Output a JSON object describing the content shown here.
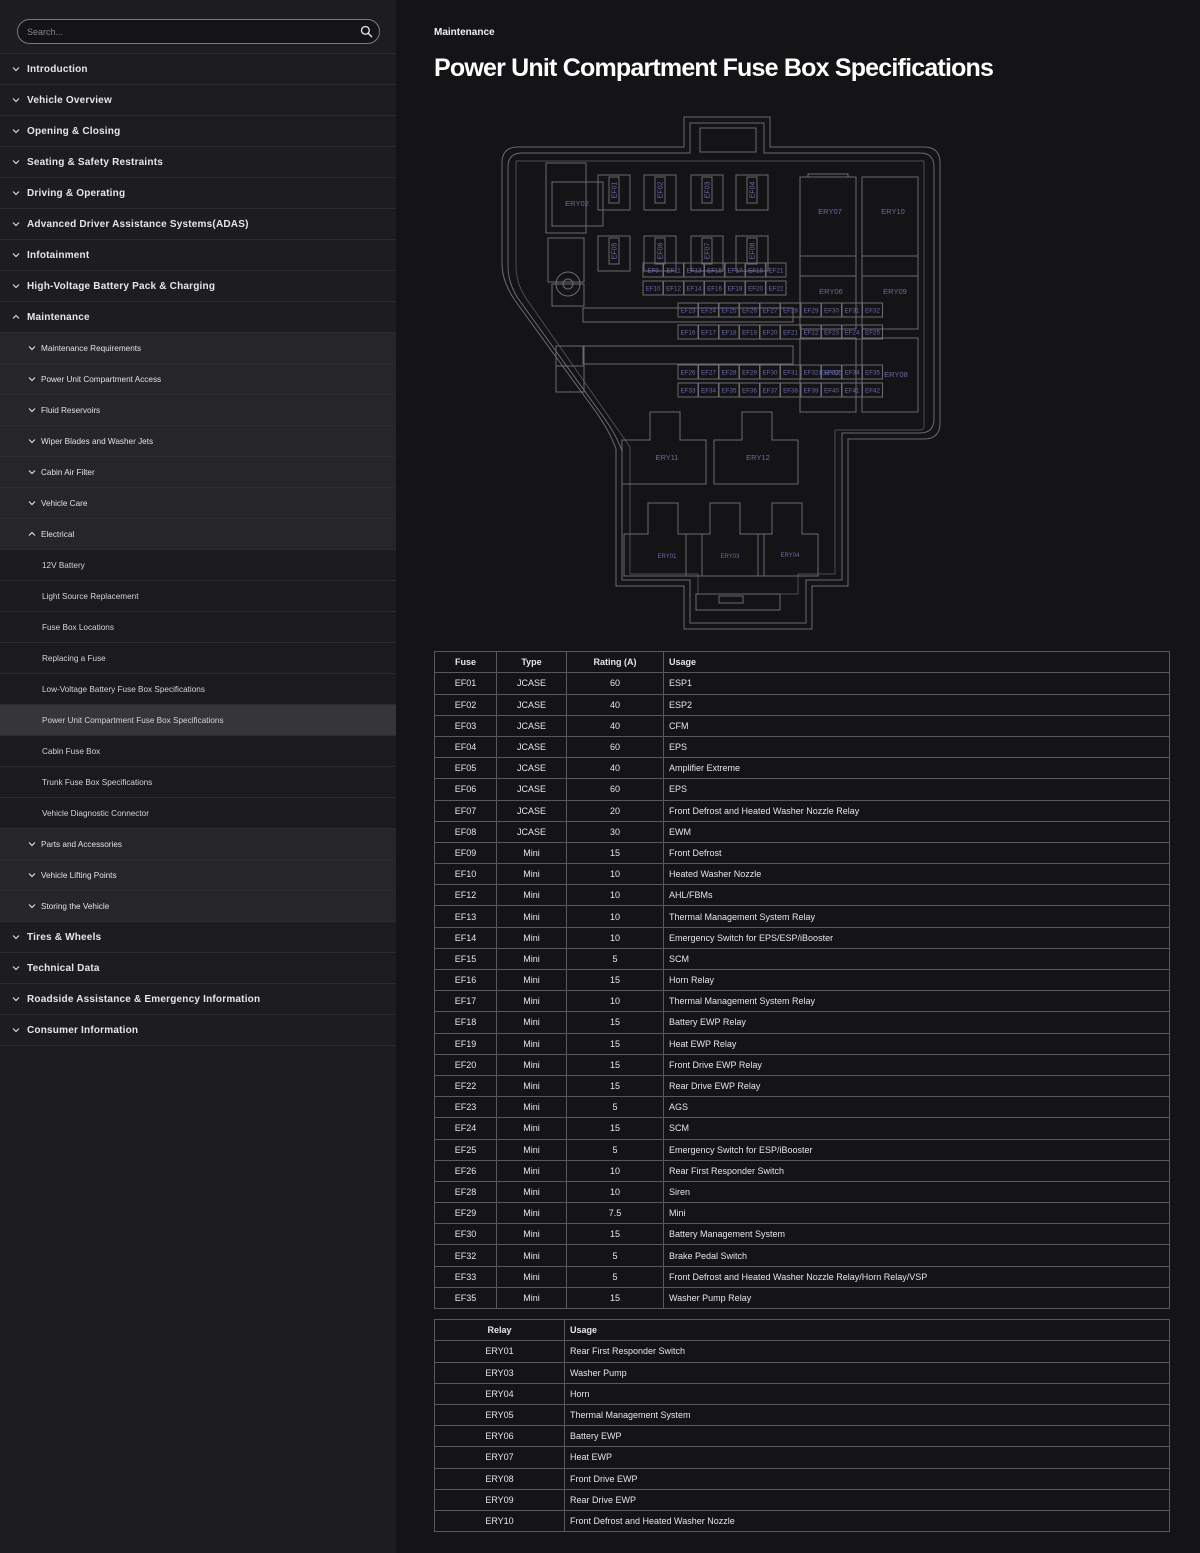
{
  "search": {
    "placeholder": "Search..."
  },
  "sidebar": {
    "items": [
      {
        "level": 1,
        "label": "Introduction",
        "expanded": false
      },
      {
        "level": 1,
        "label": "Vehicle Overview",
        "expanded": false
      },
      {
        "level": 1,
        "label": "Opening & Closing",
        "expanded": false
      },
      {
        "level": 1,
        "label": "Seating & Safety Restraints",
        "expanded": false
      },
      {
        "level": 1,
        "label": "Driving & Operating",
        "expanded": false
      },
      {
        "level": 1,
        "label": "Advanced Driver Assistance Systems(ADAS)",
        "expanded": false
      },
      {
        "level": 1,
        "label": "Infotainment",
        "expanded": false
      },
      {
        "level": 1,
        "label": "High-Voltage Battery Pack & Charging",
        "expanded": false
      },
      {
        "level": 1,
        "label": "Maintenance",
        "expanded": true
      },
      {
        "level": 2,
        "label": "Maintenance Requirements",
        "expanded": false
      },
      {
        "level": 2,
        "label": "Power Unit Compartment Access",
        "expanded": false
      },
      {
        "level": 2,
        "label": "Fluid Reservoirs",
        "expanded": false
      },
      {
        "level": 2,
        "label": "Wiper Blades and Washer Jets",
        "expanded": false
      },
      {
        "level": 2,
        "label": "Cabin Air Filter",
        "expanded": false
      },
      {
        "level": 2,
        "label": "Vehicle Care",
        "expanded": false
      },
      {
        "level": 2,
        "label": "Electrical",
        "expanded": true
      },
      {
        "level": 3,
        "label": "12V Battery"
      },
      {
        "level": 3,
        "label": "Light Source Replacement"
      },
      {
        "level": 3,
        "label": "Fuse Box Locations"
      },
      {
        "level": 3,
        "label": "Replacing a Fuse"
      },
      {
        "level": 3,
        "label": "Low-Voltage Battery Fuse Box Specifications"
      },
      {
        "level": 3,
        "label": "Power Unit Compartment Fuse Box Specifications",
        "active": true
      },
      {
        "level": 3,
        "label": "Cabin Fuse Box"
      },
      {
        "level": 3,
        "label": "Trunk Fuse Box Specifications"
      },
      {
        "level": 3,
        "label": "Vehicle Diagnostic Connector"
      },
      {
        "level": 2,
        "label": "Parts and Accessories",
        "expanded": false
      },
      {
        "level": 2,
        "label": "Vehicle Lifting Points",
        "expanded": false
      },
      {
        "level": 2,
        "label": "Storing the Vehicle",
        "expanded": false
      },
      {
        "level": 1,
        "label": "Tires & Wheels",
        "expanded": false
      },
      {
        "level": 1,
        "label": "Technical Data",
        "expanded": false
      },
      {
        "level": 1,
        "label": "Roadside Assistance & Emergency Information",
        "expanded": false
      },
      {
        "level": 1,
        "label": "Consumer Information",
        "expanded": false
      }
    ]
  },
  "main": {
    "breadcrumb": "Maintenance",
    "title": "Power Unit Compartment Fuse Box Specifications"
  },
  "diagram": {
    "big_fuses_top": [
      "EF01",
      "EF02",
      "EF03",
      "EF04"
    ],
    "big_fuses_mid": [
      "EF05",
      "EF06",
      "EF07",
      "EF08"
    ],
    "mini_rows": [
      [
        "EF9",
        "EF11",
        "EF13",
        "EF15",
        "EF17",
        "EF19",
        "EF21"
      ],
      [
        "EF10",
        "EF12",
        "EF14",
        "EF16",
        "EF18",
        "EF20",
        "EF22"
      ],
      [
        "EF23",
        "EF24",
        "EF25",
        "EF26",
        "EF27",
        "EF28",
        "EF29",
        "EF30",
        "EF31",
        "EF32"
      ],
      [
        "EF16",
        "EF17",
        "EF18",
        "EF19",
        "EF20",
        "EF21",
        "EF22",
        "EF23",
        "EF24",
        "EF25"
      ],
      [
        "EF26",
        "EF27",
        "EF28",
        "EF29",
        "EF30",
        "EF31",
        "EF32",
        "EF33",
        "EF34",
        "EF35"
      ],
      [
        "EF33",
        "EF34",
        "EF35",
        "EF36",
        "EF37",
        "EF38",
        "EF39",
        "EF40",
        "EF41",
        "EF42"
      ]
    ],
    "relays": {
      "ery02": "ERY02",
      "ery07": "ERY07",
      "ery10": "ERY10",
      "ery06": "ERY06",
      "ery09": "ERY09",
      "ery05": "ERY05",
      "ery08": "ERY08",
      "ery11": "ERY11",
      "ery12": "ERY12",
      "ery01": "ERY01",
      "ery03": "ERY03",
      "ery04": "ERY04"
    },
    "colors": {
      "outline": "#6a6a70",
      "label": "#6a6aa8",
      "fill": "#141416"
    }
  },
  "fuse_table": {
    "headers": [
      "Fuse",
      "Type",
      "Rating (A)",
      "Usage"
    ],
    "rows": [
      [
        "EF01",
        "JCASE",
        "60",
        "ESP1"
      ],
      [
        "EF02",
        "JCASE",
        "40",
        "ESP2"
      ],
      [
        "EF03",
        "JCASE",
        "40",
        "CFM"
      ],
      [
        "EF04",
        "JCASE",
        "60",
        "EPS"
      ],
      [
        "EF05",
        "JCASE",
        "40",
        "Amplifier Extreme"
      ],
      [
        "EF06",
        "JCASE",
        "60",
        "EPS"
      ],
      [
        "EF07",
        "JCASE",
        "20",
        "Front Defrost and Heated Washer Nozzle Relay"
      ],
      [
        "EF08",
        "JCASE",
        "30",
        "EWM"
      ],
      [
        "EF09",
        "Mini",
        "15",
        "Front Defrost"
      ],
      [
        "EF10",
        "Mini",
        "10",
        "Heated Washer Nozzle"
      ],
      [
        "EF12",
        "Mini",
        "10",
        "AHL/FBMs"
      ],
      [
        "EF13",
        "Mini",
        "10",
        "Thermal Management System Relay"
      ],
      [
        "EF14",
        "Mini",
        "10",
        "Emergency Switch for EPS/ESP/iBooster"
      ],
      [
        "EF15",
        "Mini",
        "5",
        "SCM"
      ],
      [
        "EF16",
        "Mini",
        "15",
        "Horn Relay"
      ],
      [
        "EF17",
        "Mini",
        "10",
        "Thermal Management System Relay"
      ],
      [
        "EF18",
        "Mini",
        "15",
        "Battery EWP Relay"
      ],
      [
        "EF19",
        "Mini",
        "15",
        "Heat EWP Relay"
      ],
      [
        "EF20",
        "Mini",
        "15",
        "Front Drive EWP Relay"
      ],
      [
        "EF22",
        "Mini",
        "15",
        "Rear Drive EWP Relay"
      ],
      [
        "EF23",
        "Mini",
        "5",
        "AGS"
      ],
      [
        "EF24",
        "Mini",
        "15",
        "SCM"
      ],
      [
        "EF25",
        "Mini",
        "5",
        "Emergency Switch for ESP/iBooster"
      ],
      [
        "EF26",
        "Mini",
        "10",
        "Rear First Responder Switch"
      ],
      [
        "EF28",
        "Mini",
        "10",
        "Siren"
      ],
      [
        "EF29",
        "Mini",
        "7.5",
        "Mini"
      ],
      [
        "EF30",
        "Mini",
        "15",
        "Battery Management System"
      ],
      [
        "EF32",
        "Mini",
        "5",
        "Brake Pedal Switch"
      ],
      [
        "EF33",
        "Mini",
        "5",
        "Front Defrost and Heated Washer Nozzle Relay/Horn Relay/VSP"
      ],
      [
        "EF35",
        "Mini",
        "15",
        "Washer Pump Relay"
      ]
    ]
  },
  "relay_table": {
    "headers": [
      "Relay",
      "Usage"
    ],
    "rows": [
      [
        "ERY01",
        "Rear First Responder Switch"
      ],
      [
        "ERY03",
        "Washer Pump"
      ],
      [
        "ERY04",
        "Horn"
      ],
      [
        "ERY05",
        "Thermal Management System"
      ],
      [
        "ERY06",
        "Battery EWP"
      ],
      [
        "ERY07",
        "Heat EWP"
      ],
      [
        "ERY08",
        "Front Drive EWP"
      ],
      [
        "ERY09",
        "Rear Drive EWP"
      ],
      [
        "ERY10",
        "Front Defrost and Heated Washer Nozzle"
      ]
    ]
  }
}
